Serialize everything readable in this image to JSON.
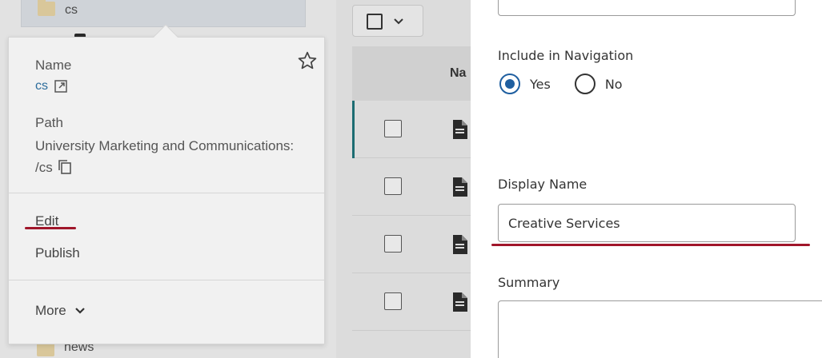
{
  "tree": {
    "items": [
      {
        "label": "cs",
        "icon": "folder-icon"
      },
      {
        "label": "news",
        "icon": "folder-icon"
      }
    ]
  },
  "popover": {
    "name_label": "Name",
    "name_value": "cs",
    "path_label": "Path",
    "path_value": "University Marketing and Communications: /cs",
    "actions": {
      "edit": "Edit",
      "publish": "Publish",
      "more": "More"
    },
    "highlight_color": "#a0162a"
  },
  "list": {
    "header_label": "Na",
    "rows": 4
  },
  "form": {
    "include_nav_label": "Include in Navigation",
    "nav_options": [
      {
        "label": "Yes",
        "selected": true
      },
      {
        "label": "No",
        "selected": false
      }
    ],
    "display_name_label": "Display Name",
    "display_name_value": "Creative Services",
    "summary_label": "Summary",
    "summary_value": ""
  },
  "colors": {
    "accent_blue": "#1f5fa0",
    "link_blue": "#2c6d9c",
    "active_row_bar": "#1c6c72",
    "annotation_red": "#a0162a"
  }
}
